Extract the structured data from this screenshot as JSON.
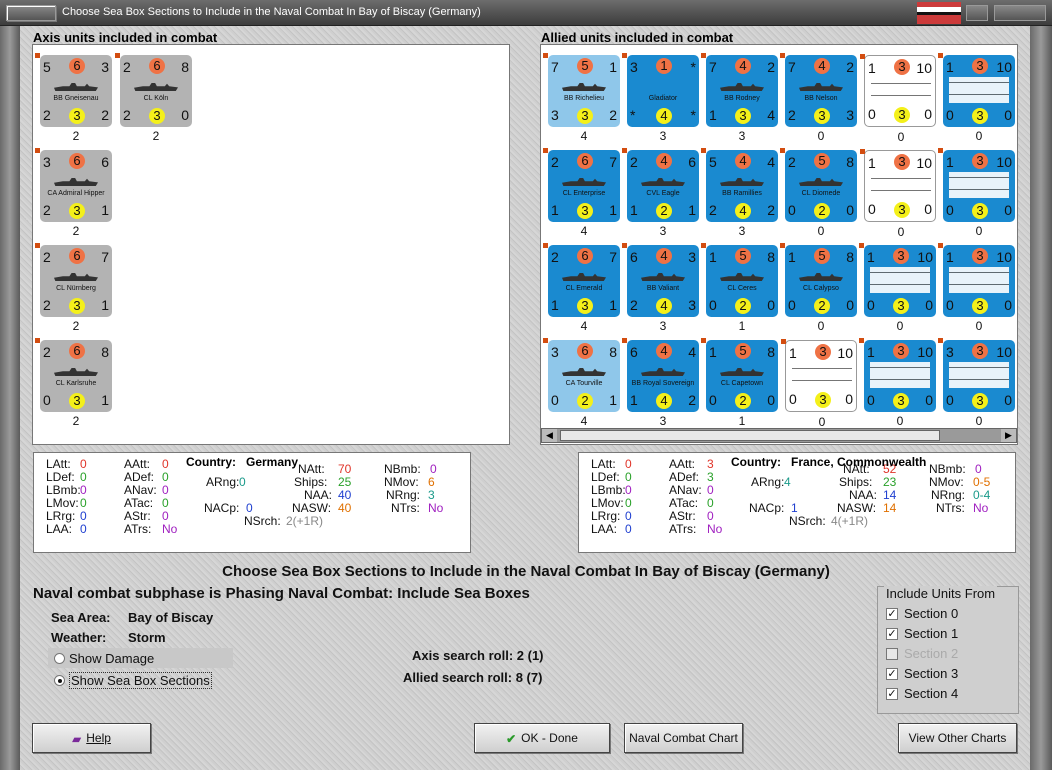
{
  "window": {
    "title": "Choose Sea Box Sections to Include in the Naval Combat In Bay of Biscay (Germany)"
  },
  "axis": {
    "heading": "Axis units included in combat",
    "units": [
      {
        "tl": "5",
        "att": "6",
        "tr": "3",
        "bl": "2",
        "def": "3",
        "br": "2",
        "name": "BB Gneisenau",
        "below": "2"
      },
      {
        "tl": "2",
        "att": "6",
        "tr": "8",
        "bl": "2",
        "def": "3",
        "br": "0",
        "name": "CL Köln",
        "below": "2"
      },
      {
        "tl": "3",
        "att": "6",
        "tr": "6",
        "bl": "2",
        "def": "3",
        "br": "1",
        "name": "CA Admiral Hipper",
        "below": "2"
      },
      {
        "tl": "2",
        "att": "6",
        "tr": "7",
        "bl": "2",
        "def": "3",
        "br": "1",
        "name": "CL Nürnberg",
        "below": "2"
      },
      {
        "tl": "2",
        "att": "6",
        "tr": "8",
        "bl": "0",
        "def": "3",
        "br": "1",
        "name": "CL Karlsruhe",
        "below": "2"
      }
    ]
  },
  "allied": {
    "heading": "Allied units included in combat",
    "units": [
      {
        "tl": "7",
        "att": "5",
        "tr": "1",
        "bl": "3",
        "def": "3",
        "br": "2",
        "name": "BB Richelieu",
        "below": "4",
        "style": "light"
      },
      {
        "tl": "3",
        "att": "1",
        "tr": "*",
        "bl": "*",
        "def": "4",
        "br": "*",
        "name": "Gladiator",
        "below": "3",
        "style": "allied"
      },
      {
        "tl": "7",
        "att": "4",
        "tr": "2",
        "bl": "1",
        "def": "3",
        "br": "4",
        "name": "BB Rodney",
        "below": "3",
        "style": "allied"
      },
      {
        "tl": "7",
        "att": "4",
        "tr": "2",
        "bl": "2",
        "def": "3",
        "br": "3",
        "name": "BB Nelson",
        "below": "0",
        "style": "allied"
      },
      {
        "tl": "1",
        "att": "3",
        "tr": "10",
        "bl": "0",
        "def": "3",
        "br": "0",
        "name": "",
        "below": "0",
        "style": "convoy"
      },
      {
        "tl": "1",
        "att": "3",
        "tr": "10",
        "bl": "0",
        "def": "3",
        "br": "0",
        "name": "",
        "below": "0",
        "style": "convoyb"
      },
      {
        "tl": "2",
        "att": "6",
        "tr": "7",
        "bl": "1",
        "def": "3",
        "br": "1",
        "name": "CL Enterprise",
        "below": "4",
        "style": "allied"
      },
      {
        "tl": "2",
        "att": "4",
        "tr": "6",
        "bl": "1",
        "def": "2",
        "br": "1",
        "name": "CVL Eagle",
        "below": "3",
        "style": "allied"
      },
      {
        "tl": "5",
        "att": "4",
        "tr": "4",
        "bl": "2",
        "def": "4",
        "br": "2",
        "name": "BB Ramillies",
        "below": "3",
        "style": "allied"
      },
      {
        "tl": "2",
        "att": "5",
        "tr": "8",
        "bl": "0",
        "def": "2",
        "br": "0",
        "name": "CL Diomede",
        "below": "0",
        "style": "allied"
      },
      {
        "tl": "1",
        "att": "3",
        "tr": "10",
        "bl": "0",
        "def": "3",
        "br": "0",
        "name": "",
        "below": "0",
        "style": "convoy"
      },
      {
        "tl": "1",
        "att": "3",
        "tr": "10",
        "bl": "0",
        "def": "3",
        "br": "0",
        "name": "",
        "below": "0",
        "style": "convoyb"
      },
      {
        "tl": "2",
        "att": "6",
        "tr": "7",
        "bl": "1",
        "def": "3",
        "br": "1",
        "name": "CL Emerald",
        "below": "4",
        "style": "allied"
      },
      {
        "tl": "6",
        "att": "4",
        "tr": "3",
        "bl": "2",
        "def": "4",
        "br": "3",
        "name": "BB Valiant",
        "below": "3",
        "style": "allied"
      },
      {
        "tl": "1",
        "att": "5",
        "tr": "8",
        "bl": "0",
        "def": "2",
        "br": "0",
        "name": "CL Ceres",
        "below": "1",
        "style": "allied"
      },
      {
        "tl": "1",
        "att": "5",
        "tr": "8",
        "bl": "0",
        "def": "2",
        "br": "0",
        "name": "CL Calypso",
        "below": "0",
        "style": "allied"
      },
      {
        "tl": "1",
        "att": "3",
        "tr": "10",
        "bl": "0",
        "def": "3",
        "br": "0",
        "name": "",
        "below": "0",
        "style": "convoyb"
      },
      {
        "tl": "1",
        "att": "3",
        "tr": "10",
        "bl": "0",
        "def": "3",
        "br": "0",
        "name": "",
        "below": "0",
        "style": "convoyb"
      },
      {
        "tl": "3",
        "att": "6",
        "tr": "8",
        "bl": "0",
        "def": "2",
        "br": "1",
        "name": "CA Tourville",
        "below": "4",
        "style": "light"
      },
      {
        "tl": "6",
        "att": "4",
        "tr": "4",
        "bl": "1",
        "def": "4",
        "br": "2",
        "name": "BB Royal Sovereign",
        "below": "3",
        "style": "allied"
      },
      {
        "tl": "1",
        "att": "5",
        "tr": "8",
        "bl": "0",
        "def": "2",
        "br": "0",
        "name": "CL Capetown",
        "below": "1",
        "style": "allied"
      },
      {
        "tl": "1",
        "att": "3",
        "tr": "10",
        "bl": "0",
        "def": "3",
        "br": "0",
        "name": "",
        "below": "0",
        "style": "convoy"
      },
      {
        "tl": "1",
        "att": "3",
        "tr": "10",
        "bl": "0",
        "def": "3",
        "br": "0",
        "name": "",
        "below": "0",
        "style": "convoyb"
      },
      {
        "tl": "3",
        "att": "3",
        "tr": "10",
        "bl": "0",
        "def": "3",
        "br": "0",
        "name": "",
        "below": "0",
        "style": "convoyb"
      }
    ]
  },
  "axis_stats": {
    "country_label": "Country:",
    "country": "Germany",
    "LAtt": "0",
    "LDef": "0",
    "LBmb": "0",
    "LMov": "0",
    "LRrg": "0",
    "LAA": "0",
    "AAtt": "0",
    "ADef": "0",
    "ANav": "0",
    "ATac": "0",
    "AStr": "0",
    "ATrs": "No",
    "ARng": "0",
    "NACp": "0",
    "NAtt": "70",
    "Ships": "25",
    "NAA": "40",
    "NASW": "40",
    "NSrch": "2(+1R)",
    "NBmb": "0",
    "NMov": "6",
    "NRng": "3",
    "NTrs": "No"
  },
  "allied_stats": {
    "country_label": "Country:",
    "country": "France, Commonwealth",
    "LAtt": "0",
    "LDef": "0",
    "LBmb": "0",
    "LMov": "0",
    "LRrg": "0",
    "LAA": "0",
    "AAtt": "3",
    "ADef": "3",
    "ANav": "0",
    "ATac": "0",
    "AStr": "0",
    "ATrs": "No",
    "ARng": "4",
    "NACp": "1",
    "NAtt": "52",
    "Ships": "23",
    "NAA": "14",
    "NASW": "14",
    "NSrch": "4(+1R)",
    "NBmb": "0",
    "NMov": "0-5",
    "NRng": "0-4",
    "NTrs": "No"
  },
  "main": {
    "title": "Choose Sea Box Sections to Include in the Naval Combat In Bay of Biscay (Germany)",
    "subphase": "Naval combat subphase is Phasing Naval Combat: Include Sea Boxes",
    "sea_area_label": "Sea Area:",
    "sea_area": "Bay of Biscay",
    "weather_label": "Weather:",
    "weather": "Storm",
    "show_damage": "Show Damage",
    "show_sections": "Show Sea Box Sections",
    "axis_roll": "Axis search roll: 2 (1)",
    "allied_roll": "Allied search roll: 8 (7)"
  },
  "include": {
    "heading": "Include Units From",
    "sections": [
      {
        "label": "Section 0",
        "checked": true,
        "disabled": false
      },
      {
        "label": "Section 1",
        "checked": true,
        "disabled": false
      },
      {
        "label": "Section 2",
        "checked": false,
        "disabled": true
      },
      {
        "label": "Section 3",
        "checked": true,
        "disabled": false
      },
      {
        "label": "Section 4",
        "checked": true,
        "disabled": false
      }
    ]
  },
  "buttons": {
    "help": "Help",
    "ok": "OK - Done",
    "chart": "Naval Combat Chart",
    "other": "View Other Charts"
  },
  "colors": {
    "allied_counter": "#1a8ad0",
    "axis_counter": "#b3b3b3",
    "attack_circle": "#ef7245",
    "defense_circle": "#f4f01a"
  }
}
